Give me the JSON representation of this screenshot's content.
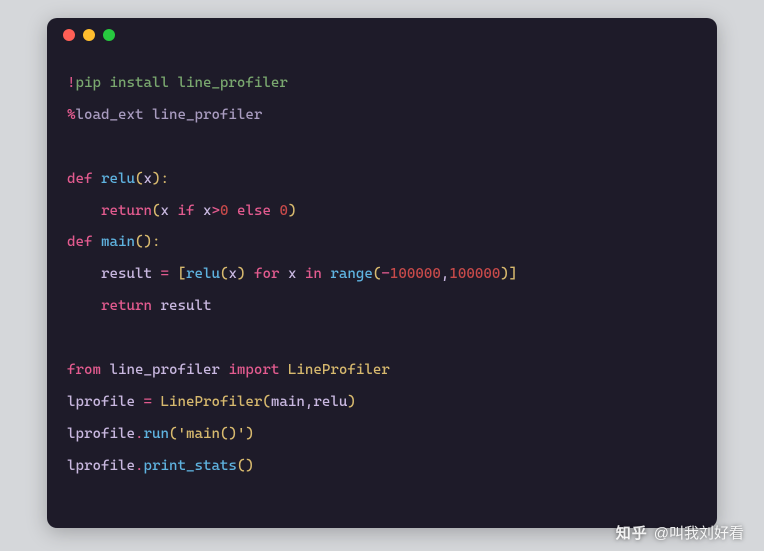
{
  "code": {
    "l1_bang": "!",
    "l1_cmd": "pip install line_profiler",
    "l2_pct": "%",
    "l2_cmd": "load_ext line_profiler",
    "l4_def": "def",
    "l4_fn": "relu",
    "l4_lp": "(",
    "l4_arg": "x",
    "l4_rp": "):",
    "l5_ret": "return",
    "l5_lp": "(",
    "l5_x1": "x ",
    "l5_if": "if",
    "l5_x2": " x",
    "l5_gt": ">",
    "l5_zero": "0",
    "l5_else": " else ",
    "l5_zero2": "0",
    "l5_rp": ")",
    "l6_def": "def",
    "l6_fn": "main",
    "l6_p": "():",
    "l7_res": "result ",
    "l7_eq": "=",
    "l7_lb": " [",
    "l7_relu": "relu",
    "l7_lp": "(",
    "l7_x": "x",
    "l7_rp": ")",
    "l7_for": " for ",
    "l7_x2": "x",
    "l7_in": " in ",
    "l7_range": "range",
    "l7_lp2": "(",
    "l7_neg": "-",
    "l7_n1": "100000",
    "l7_comma": ",",
    "l7_n2": "100000",
    "l7_rp2": ")]",
    "l8_ret": "return",
    "l8_res": " result",
    "l10_from": "from",
    "l10_mod": " line_profiler ",
    "l10_import": "import",
    "l10_cls": " LineProfiler",
    "l11_lp": "lprofile ",
    "l11_eq": "=",
    "l11_cls": " LineProfiler",
    "l11_p": "(",
    "l11_a1": "main",
    "l11_c": ",",
    "l11_a2": "relu",
    "l11_rp": ")",
    "l12_lp": "lprofile",
    "l12_dot": ".",
    "l12_run": "run",
    "l12_p": "(",
    "l12_str": "'main()'",
    "l12_rp": ")",
    "l13_lp": "lprofile",
    "l13_dot": ".",
    "l13_ps": "print_stats",
    "l13_p": "()"
  },
  "watermark": {
    "logo": "知乎",
    "text": "@叫我刘好看"
  }
}
